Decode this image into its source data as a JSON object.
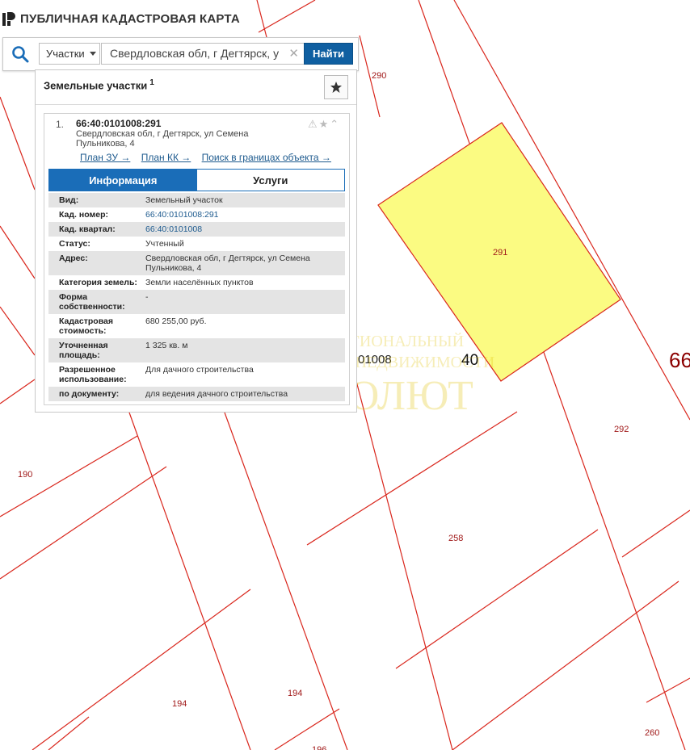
{
  "header": {
    "title": "ПУБЛИЧНАЯ КАДАСТРОВАЯ КАРТА",
    "logo_icon": "pkk-logo-icon"
  },
  "search": {
    "icon": "search-icon",
    "type_select": "Участки",
    "query": "Свердловская обл, г Дегтярск, у",
    "clear_icon": "✕",
    "button_label": "Найти"
  },
  "panel": {
    "title": "Земельные участки",
    "count": "1",
    "favorite_icon": "star-icon",
    "result": {
      "index": "1.",
      "cadastral_number": "66:40:0101008:291",
      "address": "Свердловская обл, г Дегтярск, ул Семена Пульникова, 4",
      "action_icons": "⚠★⌃",
      "links": [
        "План ЗУ →",
        "План КК →",
        "Поиск в границах объекта →"
      ],
      "tabs": [
        "Информация",
        "Услуги"
      ],
      "rows": [
        {
          "key": "Вид:",
          "value": "Земельный участок",
          "link": false
        },
        {
          "key": "Кад. номер:",
          "value": "66:40:0101008:291",
          "link": true
        },
        {
          "key": "Кад. квартал:",
          "value": "66:40:0101008",
          "link": true
        },
        {
          "key": "Статус:",
          "value": "Учтенный",
          "link": false
        },
        {
          "key": "Адрес:",
          "value": "Свердловская обл, г Дегтярск, ул Семена Пульникова, 4",
          "link": false
        },
        {
          "key": "Категория земель:",
          "value": "Земли населённых пунктов",
          "link": false
        },
        {
          "key": "Форма собственности:",
          "value": "-",
          "link": false
        },
        {
          "key": "Кадастровая стоимость:",
          "value": "680 255,00 руб.",
          "link": false
        },
        {
          "key": "Уточненная площадь:",
          "value": "1 325 кв. м",
          "link": false
        },
        {
          "key": "Разрешенное использование:",
          "value": "Для дачного строительства",
          "link": false
        },
        {
          "key": "по документу:",
          "value": "для ведения дачного строительства",
          "link": false
        }
      ]
    }
  },
  "map": {
    "parcel_labels": [
      "290",
      "291",
      "292",
      "258",
      "190",
      "194",
      "194",
      "260",
      "196"
    ],
    "quarter_label": "01008",
    "block_label": "40",
    "district_label": "66",
    "highlight_color": "#fbfb82",
    "boundary_color": "#d9261c"
  },
  "watermark": {
    "line1": "РЕГИОНАЛЬНЫЙ",
    "line2": "ЦЕНТР НЕДВИЖИМОСТИ",
    "line3": "АБСОЛЮТ"
  }
}
